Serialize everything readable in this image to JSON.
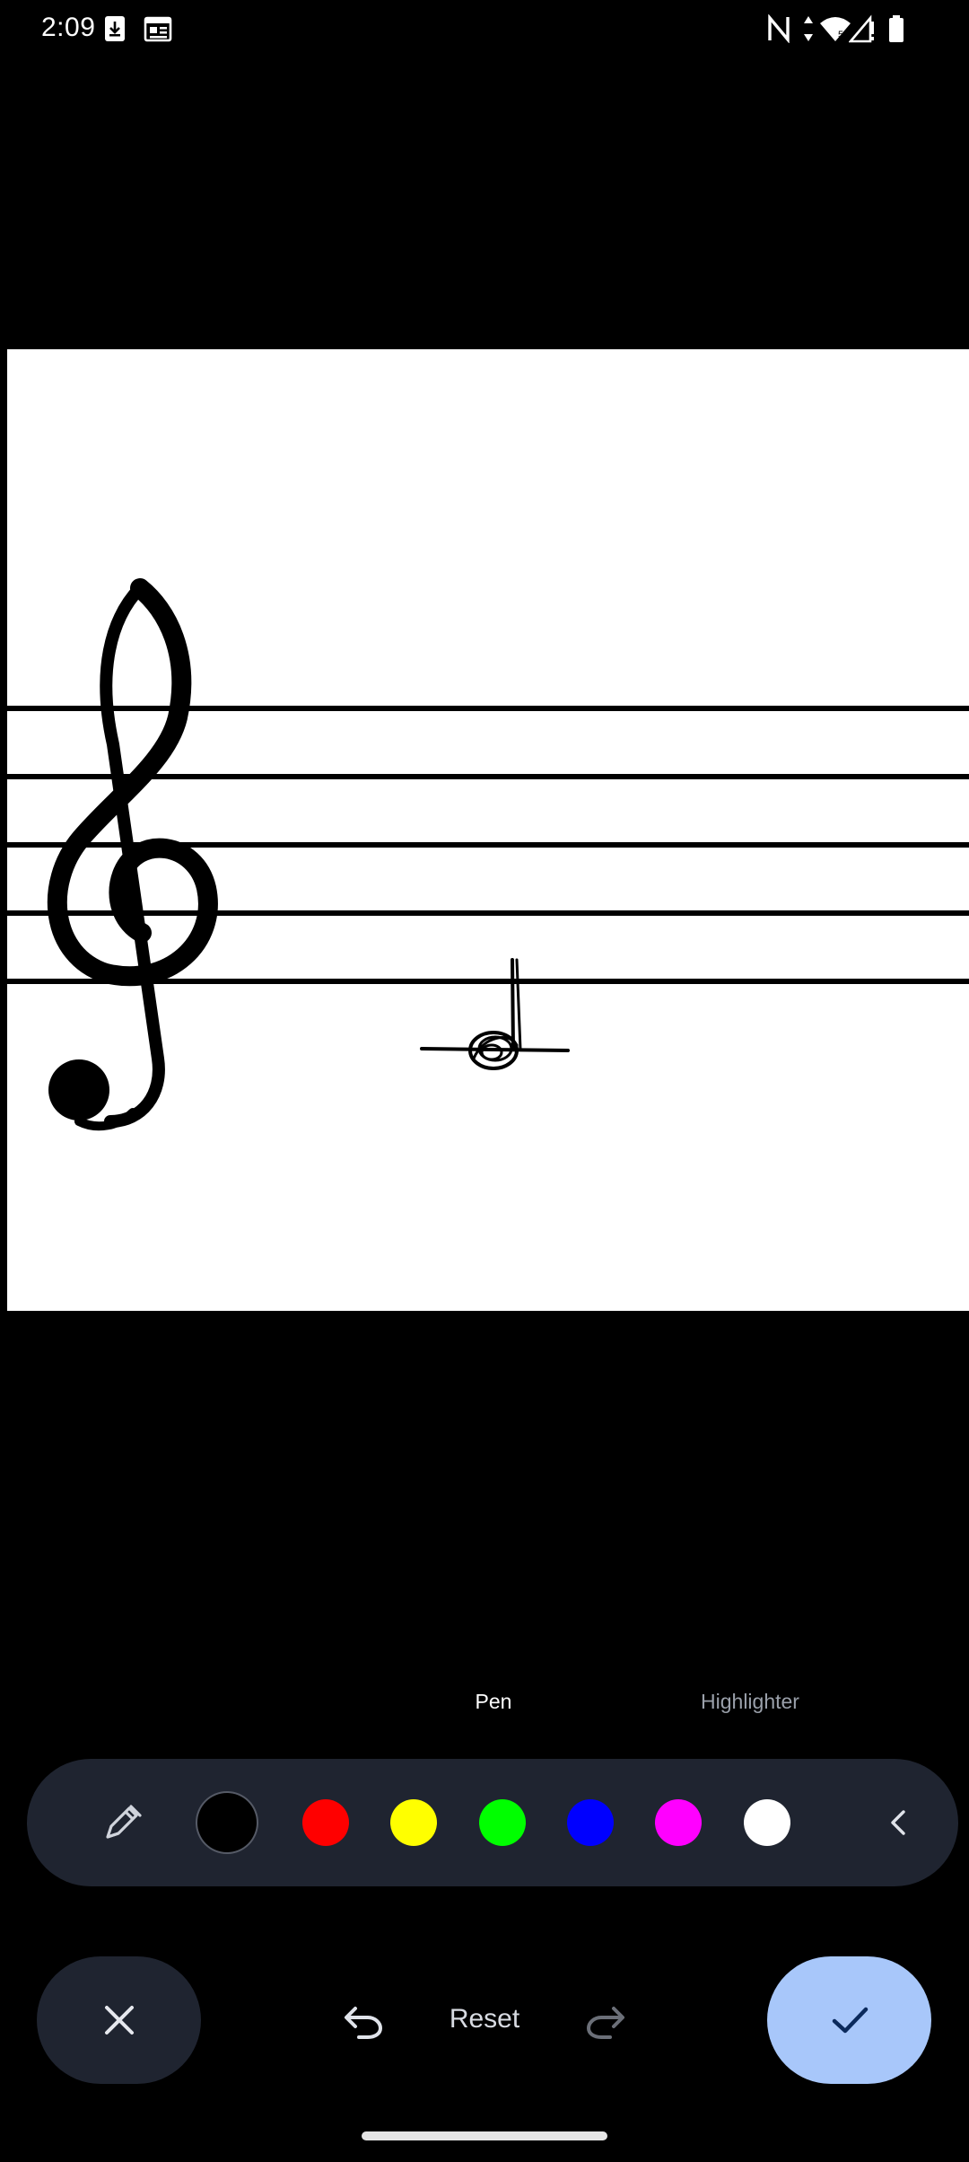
{
  "status_bar": {
    "time": "2:09",
    "left_icons": [
      "download-icon",
      "calendar-icon"
    ],
    "right_icons": [
      "nfc-icon",
      "data-arrows-icon",
      "wifi-icon",
      "signal-icon",
      "battery-icon"
    ]
  },
  "canvas": {
    "background": "#ffffff",
    "content": [
      "treble-clef-icon",
      "staff-lines",
      "hand-drawn-note"
    ]
  },
  "tool_modes": [
    {
      "label": "Pen",
      "active": true
    },
    {
      "label": "Highlighter",
      "active": false
    }
  ],
  "color_bar": {
    "pen_icon": "pen-icon",
    "colors": [
      {
        "name": "black",
        "hex": "#000000",
        "selected": true
      },
      {
        "name": "red",
        "hex": "#ff0000",
        "selected": false
      },
      {
        "name": "yellow",
        "hex": "#ffff00",
        "selected": false
      },
      {
        "name": "green",
        "hex": "#00ff00",
        "selected": false
      },
      {
        "name": "blue",
        "hex": "#0000ff",
        "selected": false
      },
      {
        "name": "magenta",
        "hex": "#ff00ff",
        "selected": false
      },
      {
        "name": "white",
        "hex": "#ffffff",
        "selected": false
      }
    ],
    "collapse_icon": "chevron-left-icon"
  },
  "actions": {
    "cancel_icon": "close-icon",
    "undo_icon": "undo-icon",
    "reset_label": "Reset",
    "redo_icon": "redo-icon",
    "done_icon": "check-icon"
  },
  "theme": {
    "toolbar_bg": "#1f2430",
    "done_bg": "#a8c7fa",
    "done_fg": "#0b2a5c"
  }
}
